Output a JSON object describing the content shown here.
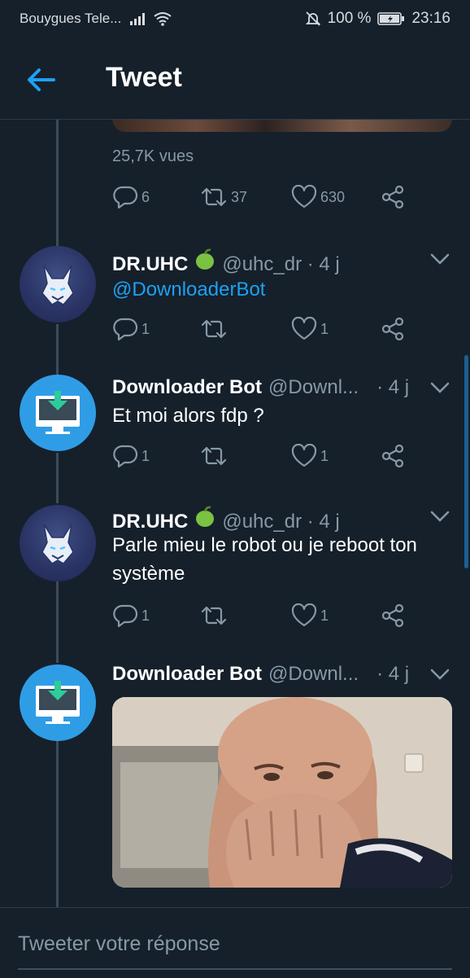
{
  "status_bar": {
    "carrier": "Bouygues Tele...",
    "battery": "100 %",
    "time": "23:16"
  },
  "header": {
    "title": "Tweet"
  },
  "prev_tweet": {
    "views": "25,7K vues",
    "replies": "6",
    "retweets": "37",
    "likes": "630"
  },
  "tweets": [
    {
      "name": "DR.UHC",
      "handle": "@uhc_dr · 4 j",
      "text": "@DownloaderBot",
      "replies": "1",
      "retweets": "",
      "likes": "1",
      "avatar": "wolf"
    },
    {
      "name": "Downloader Bot",
      "handle": "@Downl...",
      "time": "· 4 j",
      "text": "Et moi alors fdp ?",
      "replies": "1",
      "retweets": "",
      "likes": "1",
      "avatar": "download-monitor"
    },
    {
      "name": "DR.UHC",
      "handle": "@uhc_dr · 4 j",
      "text": "Parle mieu le robot ou je reboot ton système",
      "replies": "1",
      "retweets": "",
      "likes": "1",
      "avatar": "wolf"
    },
    {
      "name": "Downloader Bot",
      "handle": "@Downl...",
      "time": "· 4 j",
      "avatar": "download-monitor"
    }
  ],
  "reply": {
    "placeholder": "Tweeter votre réponse"
  },
  "colors": {
    "background": "#15202b",
    "accent": "#1da1f2",
    "muted": "#8899a6",
    "divider": "#2f3b47"
  }
}
